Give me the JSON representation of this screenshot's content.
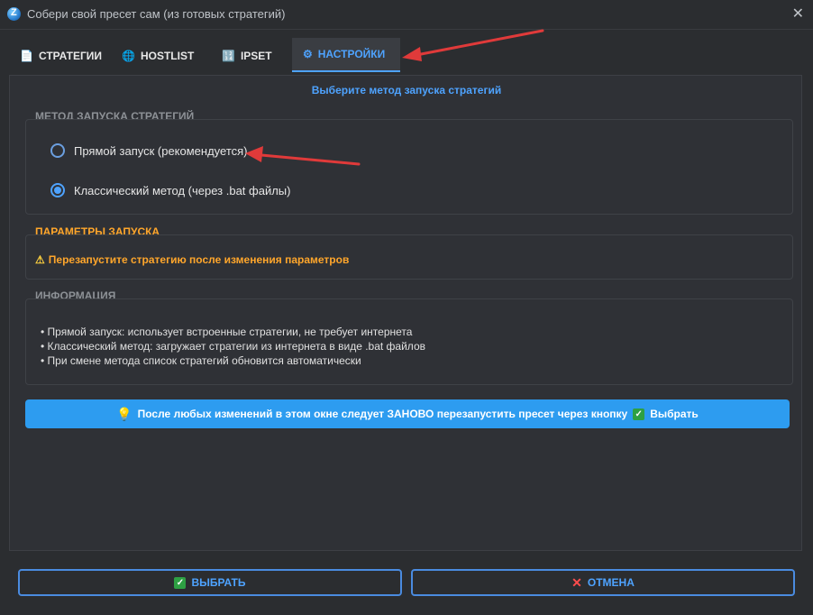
{
  "window": {
    "title": "Собери свой пресет сам (из готовых стратегий)",
    "close": "✕"
  },
  "tabs": [
    {
      "label": "СТРАТЕГИИ",
      "icon": "document-icon",
      "glyph": "📄"
    },
    {
      "label": "HOSTLIST",
      "icon": "globe-icon",
      "glyph": "🌐"
    },
    {
      "label": "IPSET",
      "icon": "grid-icon",
      "glyph": "🔢"
    },
    {
      "label": "НАСТРОЙКИ",
      "icon": "gear-icon",
      "glyph": "⚙"
    }
  ],
  "settings": {
    "subheading": "Выберите метод запуска стратегий",
    "launch_method": {
      "label": "МЕТОД ЗАПУСКА СТРАТЕГИЙ",
      "options": [
        {
          "label": "Прямой запуск (рекомендуется)",
          "checked": false
        },
        {
          "label": "Классический метод (через .bat файлы)",
          "checked": true
        }
      ]
    },
    "launch_params": {
      "label": "ПАРАМЕТРЫ ЗАПУСКА",
      "warning": "Перезапустите стратегию после изменения параметров"
    },
    "info": {
      "label": "ИНФОРМАЦИЯ",
      "items": [
        "Прямой запуск: использует встроенные стратегии, не требует интернета",
        "Классический метод: загружает стратегии из интернета в виде .bat файлов",
        "При смене метода список стратегий обновится автоматически"
      ]
    },
    "notice": {
      "text": "После любых изменений в этом окне следует ЗАНОВО перезапустить пресет через кнопку",
      "button_ref": "Выбрать"
    }
  },
  "footer": {
    "select_label": "ВЫБРАТЬ",
    "cancel_label": "ОТМЕНА"
  },
  "colors": {
    "accent": "#4ea3ff",
    "warning": "#ffa62b",
    "notice_bg": "#2d9cf0",
    "annotation_arrow": "#e03a3a"
  }
}
